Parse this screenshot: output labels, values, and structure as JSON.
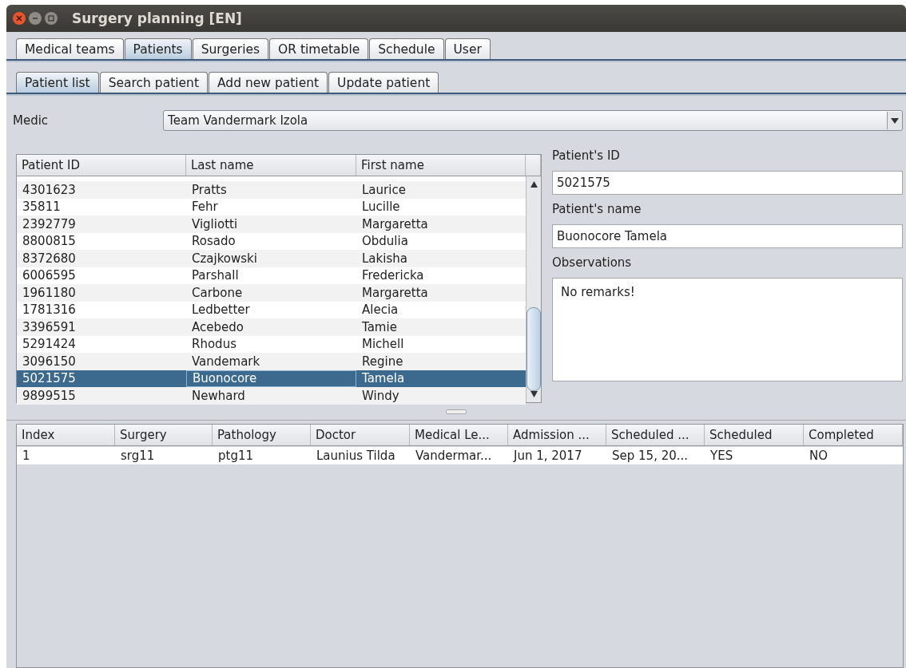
{
  "window": {
    "title": "Surgery planning [EN]"
  },
  "tabs": [
    {
      "label": "Medical teams",
      "selected": false
    },
    {
      "label": "Patients",
      "selected": true
    },
    {
      "label": "Surgeries",
      "selected": false
    },
    {
      "label": "OR timetable",
      "selected": false
    },
    {
      "label": "Schedule",
      "selected": false
    },
    {
      "label": "User",
      "selected": false
    }
  ],
  "subtabs": [
    {
      "label": "Patient list",
      "selected": true
    },
    {
      "label": "Search patient",
      "selected": false
    },
    {
      "label": "Add new patient",
      "selected": false
    },
    {
      "label": "Update patient",
      "selected": false
    }
  ],
  "medic": {
    "label": "Medic",
    "value": "Team Vandermark Izola"
  },
  "patients_table": {
    "columns": [
      "Patient ID",
      "Last name",
      "First name"
    ],
    "rows": [
      {
        "cells": [
          "4301623",
          "Pratts",
          "Laurice"
        ],
        "selected": false
      },
      {
        "cells": [
          "35811",
          "Fehr",
          "Lucille"
        ],
        "selected": false
      },
      {
        "cells": [
          "2392779",
          "Vigliotti",
          "Margaretta"
        ],
        "selected": false
      },
      {
        "cells": [
          "8800815",
          "Rosado",
          "Obdulia"
        ],
        "selected": false
      },
      {
        "cells": [
          "8372680",
          "Czajkowski",
          "Lakisha"
        ],
        "selected": false
      },
      {
        "cells": [
          "6006595",
          "Parshall",
          "Fredericka"
        ],
        "selected": false
      },
      {
        "cells": [
          "1961180",
          "Carbone",
          "Margaretta"
        ],
        "selected": false
      },
      {
        "cells": [
          "1781316",
          "Ledbetter",
          "Alecia"
        ],
        "selected": false
      },
      {
        "cells": [
          "3396591",
          "Acebedo",
          "Tamie"
        ],
        "selected": false
      },
      {
        "cells": [
          "5291424",
          "Rhodus",
          "Michell"
        ],
        "selected": false
      },
      {
        "cells": [
          "3096150",
          "Vandemark",
          "Regine"
        ],
        "selected": false
      },
      {
        "cells": [
          "5021575",
          "Buonocore",
          "Tamela"
        ],
        "selected": true
      },
      {
        "cells": [
          "9899515",
          "Newhard",
          "Windy"
        ],
        "selected": false
      }
    ]
  },
  "form": [
    {
      "label": "Patient's ID",
      "value": "5021575",
      "kind": "line"
    },
    {
      "label": "Patient's name",
      "value": "Buonocore Tamela",
      "kind": "line"
    },
    {
      "label": "Observations",
      "value": "No remarks!",
      "kind": "area"
    }
  ],
  "surgeries_table": {
    "columns": [
      "Index",
      "Surgery",
      "Pathology",
      "Doctor",
      "Medical Le...",
      "Admission ...",
      "Scheduled ...",
      "Scheduled",
      "Completed"
    ],
    "rows": [
      {
        "cells": [
          "1",
          "srg11",
          "ptg11",
          "Launius Tilda",
          "Vandermar...",
          "Jun 1, 2017",
          "Sep 15, 20...",
          "YES",
          "NO"
        ],
        "selected": false
      }
    ]
  }
}
